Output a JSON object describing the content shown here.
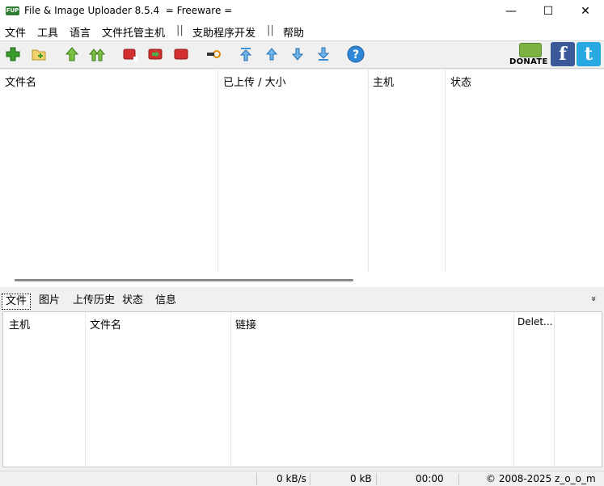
{
  "window": {
    "icon_text": "FUP",
    "title": "File & Image Uploader 8.5.4  = Freeware =",
    "minimize": "—",
    "maximize": "☐",
    "close": "✕"
  },
  "menu": {
    "items": [
      "文件",
      "工具",
      "语言",
      "文件托管主机",
      "||",
      "支助程序开发",
      "||",
      "帮助"
    ]
  },
  "toolbar": {
    "donate_label": "DONATE",
    "facebook_glyph": "f",
    "twitter_glyph": "t",
    "help_glyph": "?",
    "colors": {
      "green": "#3a9a2a",
      "red": "#d32f2f",
      "blue": "#3b8fd9",
      "facebook": "#3b5998",
      "twitter": "#29a9e1"
    }
  },
  "files_table": {
    "columns": [
      "文件名",
      "已上传 / 大小",
      "主机",
      "状态"
    ]
  },
  "tabs": [
    "文件",
    "图片",
    "上传历史",
    "状态",
    "信息"
  ],
  "collapse_glyph": "»",
  "links_table": {
    "columns": [
      "主机",
      "文件名",
      "链接",
      "Delet..."
    ]
  },
  "status": {
    "speed": "0 kB/s",
    "size": "0 kB",
    "time": "00:00",
    "copyright": "© 2008-2025 z_o_o_m"
  }
}
